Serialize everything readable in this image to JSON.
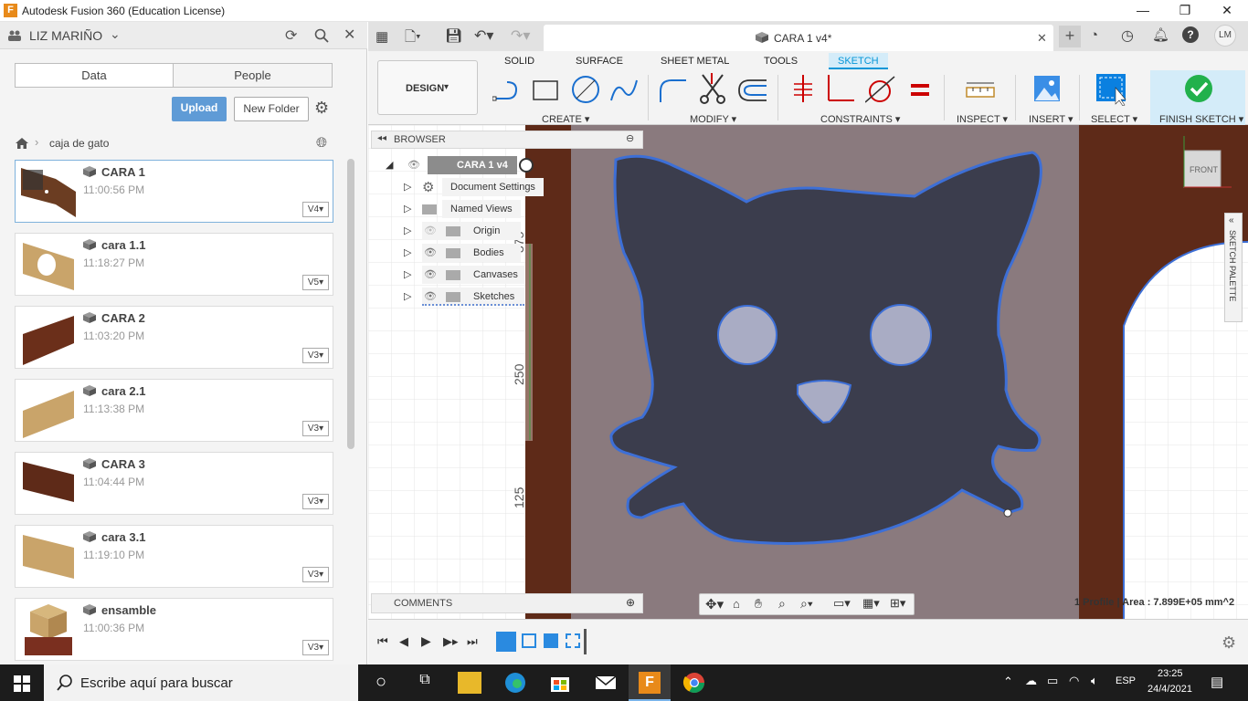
{
  "window": {
    "title": "Autodesk Fusion 360 (Education License)",
    "app_icon_letter": "F",
    "minimize": "—",
    "maximize": "❐",
    "close": "✕"
  },
  "left_panel": {
    "user": "LIZ MARIÑO",
    "tabs": [
      "Data",
      "People"
    ],
    "upload_label": "Upload",
    "new_folder_label": "New Folder",
    "breadcrumb": "caja de gato",
    "files": [
      {
        "name": "CARA 1",
        "time": "11:00:56 PM",
        "version": "V4"
      },
      {
        "name": "cara 1.1",
        "time": "11:18:27 PM",
        "version": "V5"
      },
      {
        "name": "CARA 2",
        "time": "11:03:20 PM",
        "version": "V3"
      },
      {
        "name": "cara 2.1",
        "time": "11:13:38 PM",
        "version": "V3"
      },
      {
        "name": "CARA 3",
        "time": "11:04:44 PM",
        "version": "V3"
      },
      {
        "name": "cara 3.1",
        "time": "11:19:10 PM",
        "version": "V3"
      },
      {
        "name": "ensamble",
        "time": "11:00:36 PM",
        "version": "V3"
      }
    ]
  },
  "doc_tab": {
    "title": "CARA 1 v4*",
    "close": "✕"
  },
  "user_initials": "LM",
  "ribbon": {
    "workspace": "DESIGN",
    "tabs": [
      "SOLID",
      "SURFACE",
      "SHEET METAL",
      "TOOLS",
      "SKETCH"
    ],
    "groups": [
      "CREATE",
      "MODIFY",
      "CONSTRAINTS",
      "INSPECT",
      "INSERT",
      "SELECT",
      "FINISH SKETCH"
    ]
  },
  "browser": {
    "title": "BROWSER",
    "root": "CARA 1 v4",
    "nodes": [
      "Document Settings",
      "Named Views",
      "Origin",
      "Bodies",
      "Canvases",
      "Sketches"
    ]
  },
  "comments_label": "COMMENTS",
  "ruler_labels": [
    "375",
    "250",
    "125"
  ],
  "viewcube_label": "FRONT",
  "sketch_palette_label": "SKETCH PALETTE",
  "status": "1 Profile | Area : 7.899E+05 mm^2",
  "taskbar": {
    "search_placeholder": "Escribe aquí para buscar",
    "lang": "ESP",
    "time": "23:25",
    "date": "24/4/2021"
  },
  "colors": {
    "accent": "#0696d7",
    "sketch_line": "#3d6fd6",
    "finish_green": "#22b14c",
    "upload_blue": "#5f9bd6"
  }
}
